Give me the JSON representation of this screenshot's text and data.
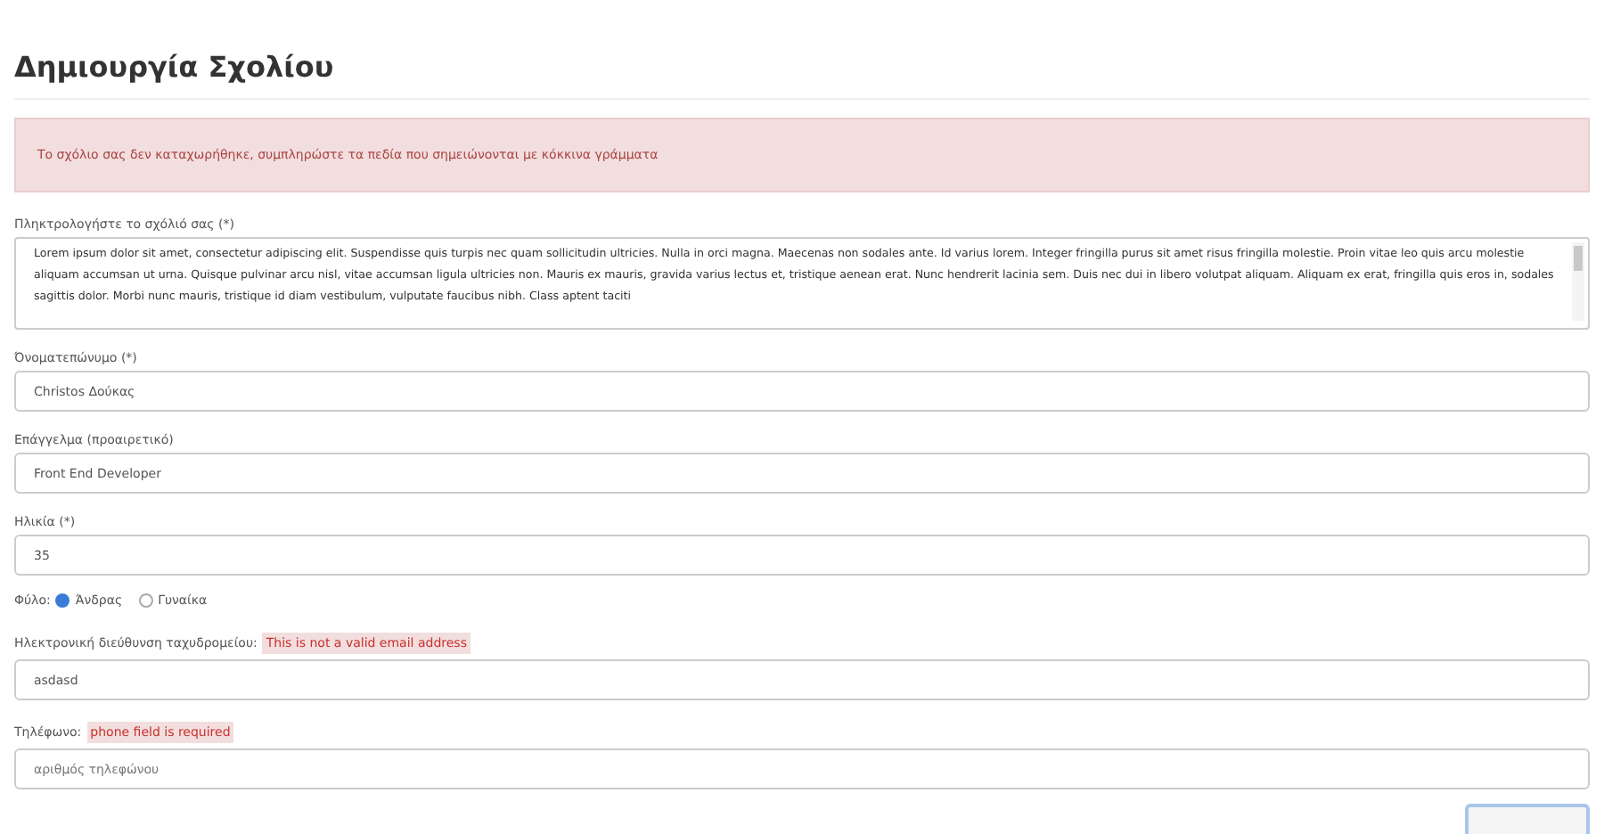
{
  "title": "Δημιουργία Σχολίου",
  "alert": "Το σχόλιο σας δεν καταχωρήθηκε, συμπληρώστε τα πεδία που σημειώνονται με κόκκινα γράμματα",
  "comment": {
    "label": "Πληκτρολογήστε το σχόλιό σας (*)",
    "value": "Lorem ipsum dolor sit amet, consectetur adipiscing elit. Suspendisse quis turpis nec quam sollicitudin ultricies. Nulla in orci magna. Maecenas non sodales ante. Id varius lorem. Integer fringilla purus sit amet risus fringilla molestie. Proin vitae leo quis arcu molestie aliquam accumsan ut urna. Quisque pulvinar arcu nisl, vitae accumsan ligula ultricies non. Mauris ex mauris, gravida varius lectus et, tristique aenean erat. Nunc hendrerit lacinia sem. Duis nec dui in libero volutpat aliquam. Aliquam ex erat, fringilla quis eros in, sodales sagittis dolor. Morbi nunc mauris, tristique id diam vestibulum, vulputate faucibus nibh. Class aptent taciti"
  },
  "fields": [
    {
      "label": "Όνοματεπώνυμο (*)",
      "value": "Christos Δούκας"
    },
    {
      "label": "Επάγγελμα (προαιρετικό)",
      "value": "Front End Developer"
    },
    {
      "label": "Ηλικία (*)",
      "value": "35"
    }
  ],
  "gender": {
    "label": "Φύλο:",
    "options": [
      {
        "label": "Άνδρας",
        "selected": true
      },
      {
        "label": "Γυναίκα",
        "selected": false
      }
    ]
  },
  "contact_fields": [
    {
      "label": "Ηλεκτρονική διεύθυνση ταχυδρομείου:",
      "error": "This is not a valid email address",
      "value": "asdasd"
    },
    {
      "label": "Τηλέφωνο:",
      "error": "phone field is required",
      "placeholder": "αριθμός τηλεφώνου"
    }
  ]
}
